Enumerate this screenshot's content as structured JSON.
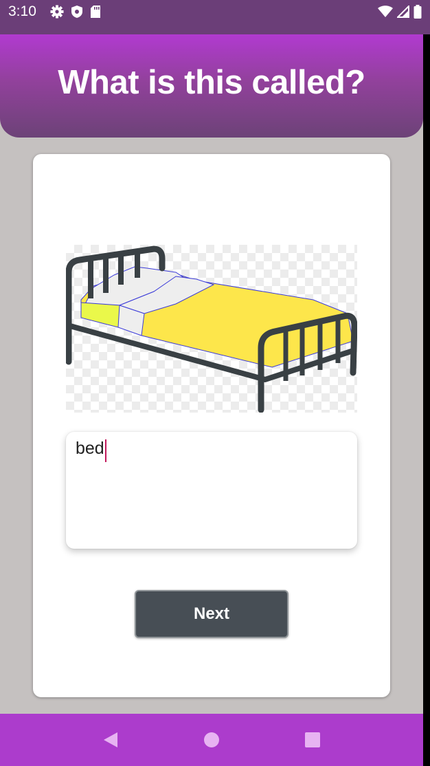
{
  "status_bar": {
    "time": "3:10",
    "left_icons": [
      "gear-icon",
      "shield-icon",
      "sd-card-icon"
    ],
    "right_icons": [
      "wifi-icon",
      "signal-icon",
      "battery-icon"
    ]
  },
  "app_bar": {
    "title": "What is this called?"
  },
  "question": {
    "image": "bed-illustration",
    "answer_value": "bed"
  },
  "actions": {
    "next_label": "Next"
  },
  "nav_bar": {
    "icons": [
      "back-icon",
      "home-icon",
      "recents-icon"
    ]
  },
  "colors": {
    "app_bar_top": "#b13ad0",
    "app_bar_bottom": "#6c4277",
    "nav_bar": "#ac3ccc",
    "button": "#474e55",
    "caret": "#c2185b",
    "background": "#c5c1c0"
  }
}
